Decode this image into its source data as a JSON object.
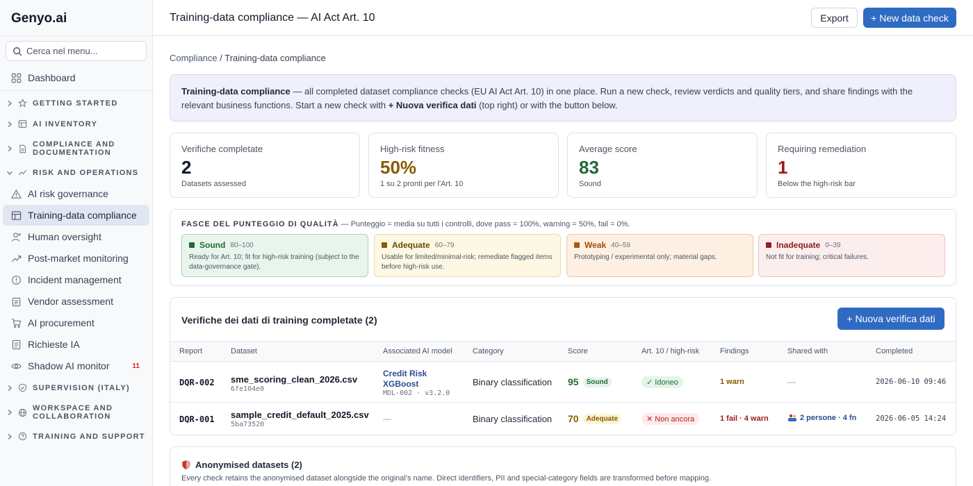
{
  "app": {
    "brand": "Genyo.ai"
  },
  "sidebar": {
    "search_placeholder": "Cerca nel menu...",
    "dashboard": "Dashboard",
    "sections": {
      "getting_started": "GETTING STARTED",
      "ai_inventory": "AI INVENTORY",
      "compliance_line1": "COMPLIANCE AND",
      "compliance_line2": "DOCUMENTATION",
      "risk_ops": "RISK AND OPERATIONS",
      "supervision": "SUPERVISION (ITALY)",
      "workspace_line1": "WORKSPACE AND",
      "workspace_line2": "COLLABORATION",
      "training": "TRAINING AND SUPPORT"
    },
    "items": {
      "ai_risk": "AI risk governance",
      "training_data": "Training-data compliance",
      "human_oversight": "Human oversight",
      "post_market": "Post-market monitoring",
      "incident": "Incident management",
      "vendor": "Vendor assessment",
      "procurement": "AI procurement",
      "richieste": "Richieste IA",
      "shadow": "Shadow AI monitor",
      "shadow_badge": "11"
    }
  },
  "header": {
    "title": "Training-data compliance — AI Act Art. 10",
    "export_label": "Export",
    "new_check_label": "+ New data check"
  },
  "breadcrumb": {
    "parent": "Compliance",
    "sep": " / ",
    "current": "Training-data compliance"
  },
  "info": {
    "bold_lead": "Training-data compliance",
    "text1": " — all completed dataset compliance checks (EU AI Act Art. 10) in one place. Run a new check, review verdicts and quality tiers, and share findings with the relevant business functions. Start a new check with ",
    "bold_action": "+ Nuova verifica dati",
    "text2": " (top right) or with the button below."
  },
  "stats": [
    {
      "label": "Verifiche completate",
      "value": "2",
      "sub": "Datasets assessed",
      "color": "#111827"
    },
    {
      "label": "High-risk fitness",
      "value": "50%",
      "sub": "1 su 2 pronti per l'Art. 10",
      "color": "#8a5a00"
    },
    {
      "label": "Average score",
      "value": "83",
      "sub": "Sound",
      "color": "#1f6b35"
    },
    {
      "label": "Requiring remediation",
      "value": "1",
      "sub": "Below the high-risk bar",
      "color": "#9b1c1c"
    }
  ],
  "tiers": {
    "heading": "FASCE DEL PUNTEGGIO DI QUALITÀ",
    "note": " — Punteggio = media su tutti i controlli, dove pass = 100%, warning = 50%, fail = 0%.",
    "items": [
      {
        "name": "Sound",
        "range": "80–100",
        "desc": "Ready for Art. 10; fit for high-risk training (subject to the data-governance gate).",
        "color": "#1f6b35"
      },
      {
        "name": "Adequate",
        "range": "60–79",
        "desc": "Usable for limited/minimal-risk; remediate flagged items before high-risk use.",
        "color": "#8a5a00"
      },
      {
        "name": "Weak",
        "range": "40–59",
        "desc": "Prototyping / experimental only; material gaps.",
        "color": "#b45309"
      },
      {
        "name": "Inadequate",
        "range": "0–39",
        "desc": "Not fit for training; critical failures.",
        "color": "#9b1c1c"
      }
    ]
  },
  "table": {
    "title": "Verifiche dei dati di training completate (2)",
    "button_label": "Nuova verifica dati",
    "columns": [
      "Report",
      "Dataset",
      "Associated AI model",
      "Category",
      "Score",
      "Art. 10 / high-risk",
      "Findings",
      "Shared with",
      "Completed"
    ],
    "rows": [
      {
        "report": "DQR-002",
        "dataset": "sme_scoring_clean_2026.csv",
        "hash": "6fe104e0",
        "model_line1": "Credit Risk",
        "model_line2": "XGBoost",
        "model_version": "MDL-002 · v3.2.0",
        "category": "Binary classification",
        "score": "95",
        "tier": "Sound",
        "art10": "✓ Idoneo",
        "findings": "1 warn",
        "shared": "—",
        "completed": "2026-06-10 09:46"
      },
      {
        "report": "DQR-001",
        "dataset": "sample_credit_default_2025.csv",
        "hash": "5ba73520",
        "model_none": "—",
        "category": "Binary classification",
        "score": "70",
        "tier": "Adequate",
        "art10": "✕ Non ancora",
        "findings": "1 fail · 4 warn",
        "shared": "2 persone · 4 fn",
        "completed": "2026-06-05 14:24"
      }
    ]
  },
  "anon": {
    "title": "Anonymised datasets (2)",
    "desc": "Every check retains the anonymised dataset alongside the original's name. Direct identifiers, PII and special-category fields are transformed before mapping."
  }
}
